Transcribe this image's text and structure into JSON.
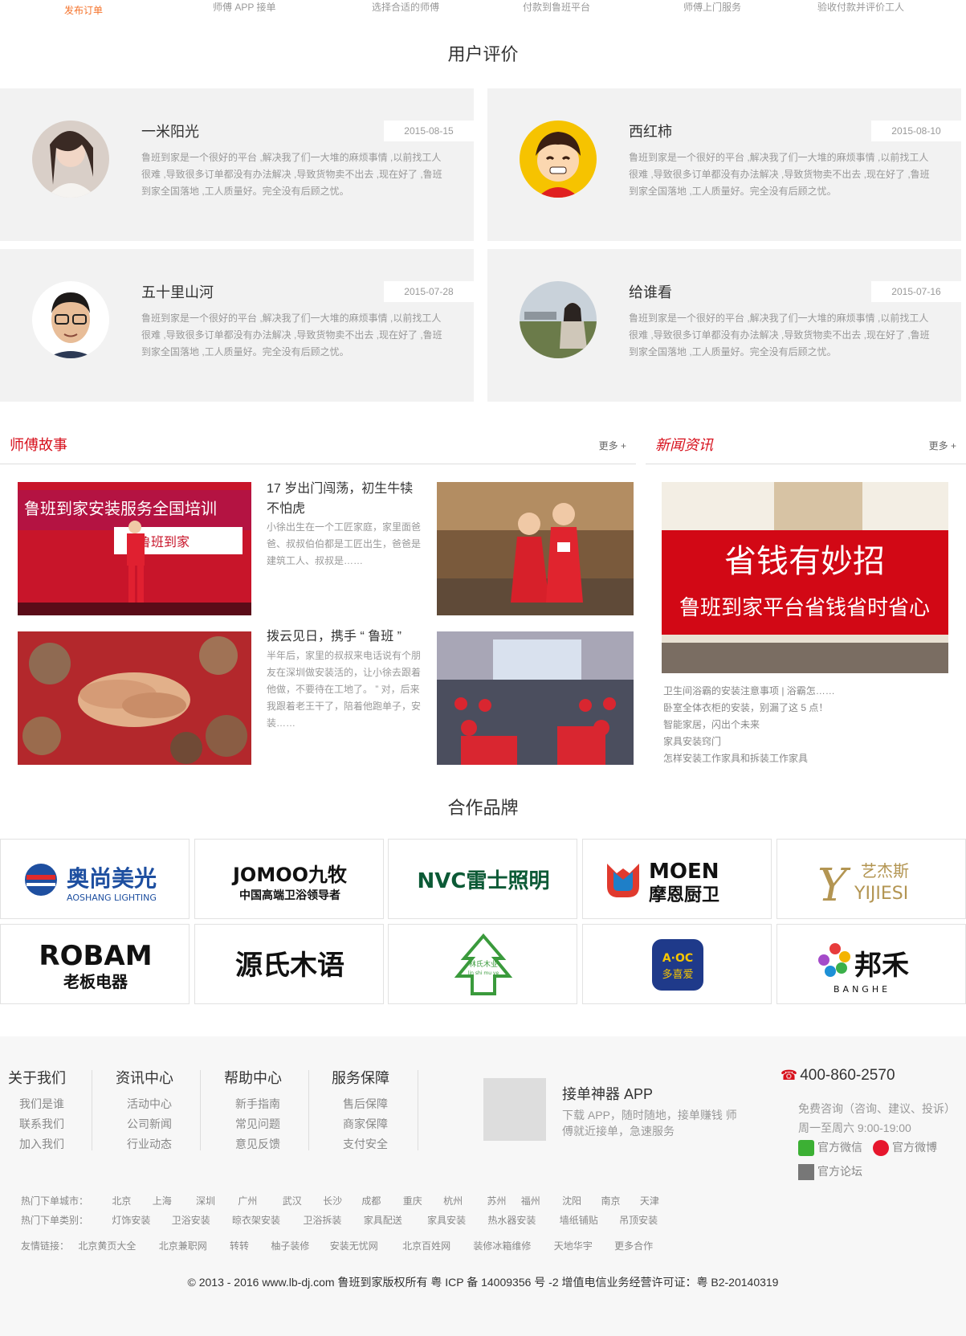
{
  "steps": [
    "发布订单",
    "师傅 APP 接单",
    "选择合适的师傅",
    "付款到鲁班平台",
    "师傅上门服务",
    "验收付款并评价工人"
  ],
  "reviews_title": "用户评价",
  "reviews": [
    {
      "name": "一米阳光",
      "date": "2015-08-15",
      "text": "鲁班到家是一个很好的平台 ,解决我了们一大堆的麻烦事情 ,以前找工人很难 ,导致很多订单都没有办法解决 ,导致货物卖不出去 ,现在好了 ,鲁班到家全国落地 ,工人质量好。完全没有后顾之忧。"
    },
    {
      "name": "西红柿",
      "date": "2015-08-10",
      "text": "鲁班到家是一个很好的平台 ,解决我了们一大堆的麻烦事情 ,以前找工人很难 ,导致很多订单都没有办法解决 ,导致货物卖不出去 ,现在好了 ,鲁班到家全国落地 ,工人质量好。完全没有后顾之忧。"
    },
    {
      "name": "五十里山河",
      "date": "2015-07-28",
      "text": "鲁班到家是一个很好的平台 ,解决我了们一大堆的麻烦事情 ,以前找工人很难 ,导致很多订单都没有办法解决 ,导致货物卖不出去 ,现在好了 ,鲁班到家全国落地 ,工人质量好。完全没有后顾之忧。"
    },
    {
      "name": "给谁看",
      "date": "2015-07-16",
      "text": "鲁班到家是一个很好的平台 ,解决我了们一大堆的麻烦事情 ,以前找工人很难 ,导致很多订单都没有办法解决 ,导致货物卖不出去 ,现在好了 ,鲁班到家全国落地 ,工人质量好。完全没有后顾之忧。"
    }
  ],
  "stories": {
    "title": "师傅故事",
    "more": "更多 +",
    "items": [
      {
        "title": "17 岁出门闯荡，初生牛犊不怕虎",
        "text": "小徐出生在一个工匠家庭，家里面爸爸、叔叔伯伯都是工匠出生，爸爸是建筑工人、叔叔是……",
        "banner": "鲁班到家安装服务全国培训",
        "banner2": "鲁班到家"
      },
      {
        "title": "拨云见日，携手 “ 鲁班 ”",
        "text": "半年后，家里的叔叔来电话说有个朋友在深圳做安装活的，让小徐去跟着他做，不要待在工地了。 ” 对，后来我跟着老王干了，陪着他跑单子，安装……"
      }
    ]
  },
  "news": {
    "title": "新闻资讯",
    "more": "更多 +",
    "banner_line1": "省钱有妙招",
    "banner_line2": "鲁班到家平台省钱省时省心",
    "items": [
      "卫生间浴霸的安装注意事项 | 浴霸怎……",
      "卧室全体衣柜的安装，别漏了这 5 点！",
      "智能家居，闪出个未来",
      "家具安装窍门",
      "怎样安装工作家具和拆装工作家具"
    ]
  },
  "brands_title": "合作品牌",
  "brands": [
    {
      "name": "奥尚美光",
      "sub": "AOSHANG LIGHTING"
    },
    {
      "name": "JOMOO九牧",
      "sub": "中国高端卫浴领导者"
    },
    {
      "name": "NVC雷士照明",
      "sub": ""
    },
    {
      "name": "MOEN",
      "sub": "摩恩厨卫"
    },
    {
      "name": "艺杰斯",
      "sub": "YIJIESI"
    },
    {
      "name": "ROBAM",
      "sub": "老板电器"
    },
    {
      "name": "源氏木语",
      "sub": ""
    },
    {
      "name": "林氏木业",
      "sub": "lin shi mu ye"
    },
    {
      "name": "A·OC",
      "sub": "多喜爱"
    },
    {
      "name": "邦禾",
      "sub": "BANGHE"
    }
  ],
  "footer": {
    "columns": [
      {
        "title": "关于我们",
        "links": [
          "我们是谁",
          "联系我们",
          "加入我们"
        ]
      },
      {
        "title": "资讯中心",
        "links": [
          "活动中心",
          "公司新闻",
          "行业动态"
        ]
      },
      {
        "title": "帮助中心",
        "links": [
          "新手指南",
          "常见问题",
          "意见反馈"
        ]
      },
      {
        "title": "服务保障",
        "links": [
          "售后保障",
          "商家保障",
          "支付安全"
        ]
      }
    ],
    "app_title": "接单神器 APP",
    "app_desc": "下载 APP，随时随地，接单赚钱 师傅就近接单，急速服务",
    "phone": "400-860-2570",
    "consult_1": "免费咨询（咨询、建议、投诉）",
    "consult_2": "周一至周六 9:00-19:00",
    "wechat": "官方微信",
    "weibo": "官方微博",
    "forum": "官方论坛",
    "hot_cities_label": "热门下单城市：",
    "hot_cities": [
      "北京",
      "上海",
      "深圳",
      "广州",
      "武汉",
      "长沙",
      "成都",
      "重庆",
      "杭州",
      "苏州",
      "福州",
      "沈阳",
      "南京",
      "天津"
    ],
    "hot_types_label": "热门下单类别：",
    "hot_types": [
      "灯饰安装",
      "卫浴安装",
      "晾衣架安装",
      "卫浴拆装",
      "家具配送",
      "家具安装",
      "热水器安装",
      "墙纸铺贴",
      "吊顶安装"
    ],
    "links_label": "友情链接：",
    "links": [
      "北京黄页大全",
      "北京兼职网",
      "转转",
      "柚子装修",
      "安装无忧网",
      "北京百姓网",
      "装修冰箱维修",
      "天地华宇",
      "更多合作"
    ],
    "copyright": "© 2013 - 2016 www.lb-dj.com 鲁班到家版权所有 粤 ICP 备 14009356 号 -2 增值电信业务经营许可证：粤 B2-20140319"
  },
  "colors": {
    "accent": "#f5732b",
    "red": "#d7101c"
  }
}
